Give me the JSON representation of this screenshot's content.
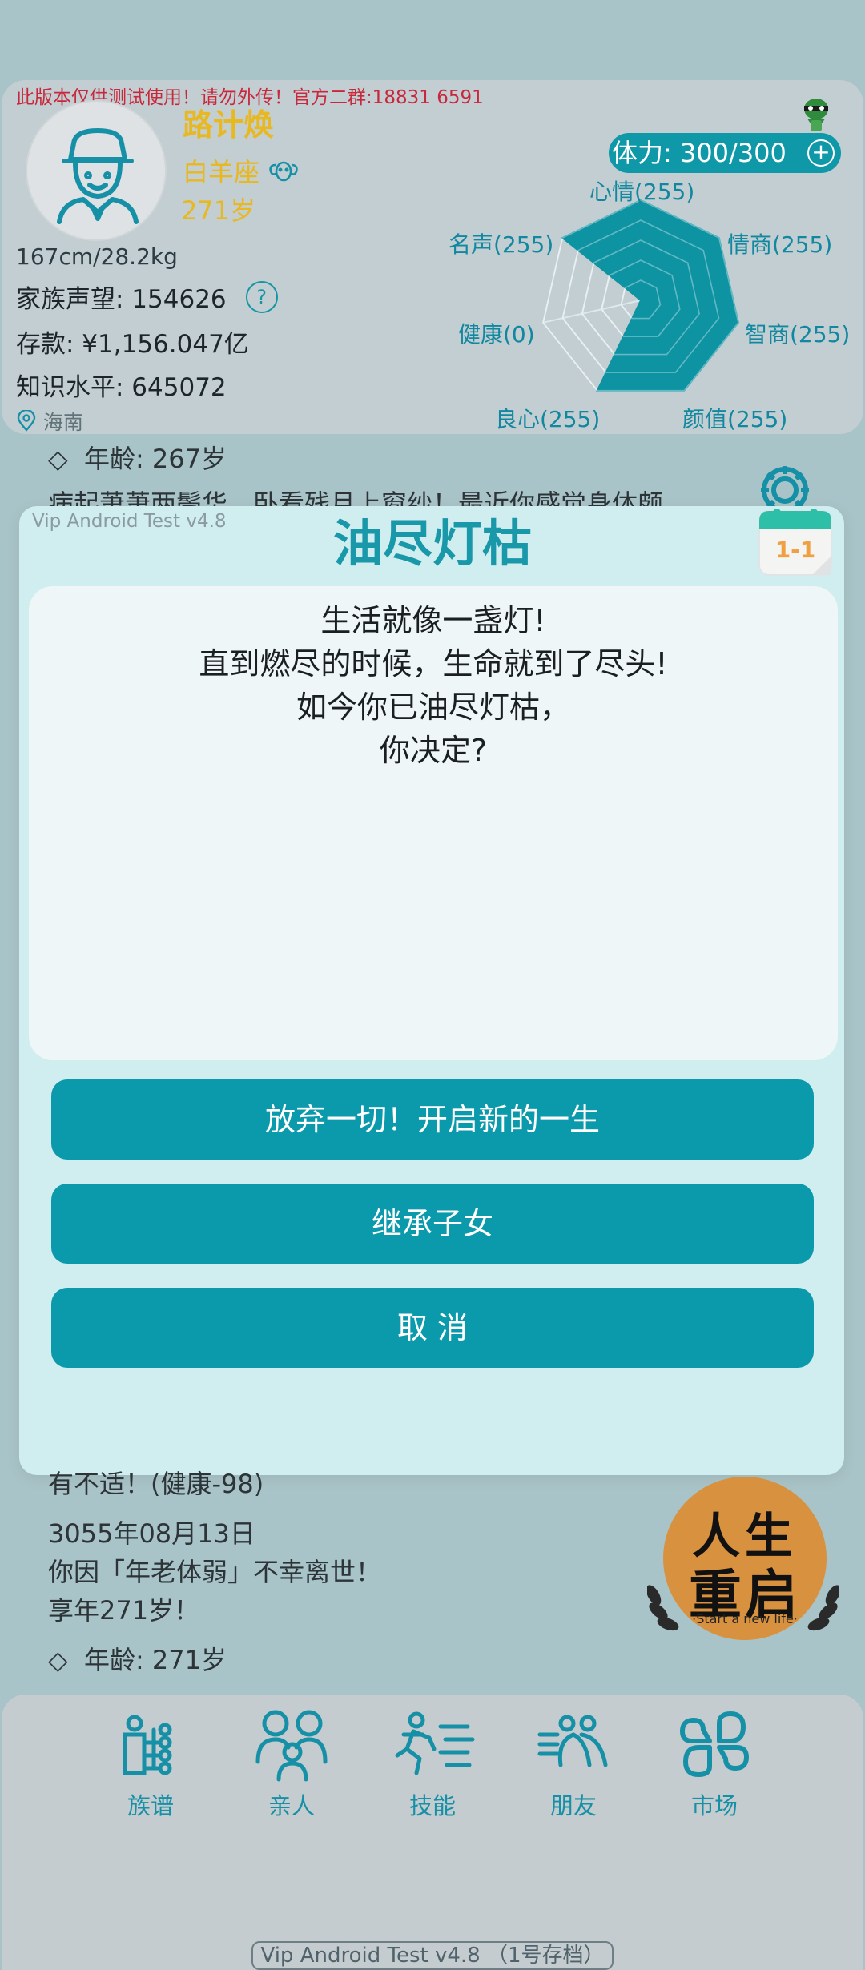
{
  "banner": {
    "warning": "此版本仅供测试使用！请勿外传！官方二群:18831 6591"
  },
  "profile": {
    "name": "路计焕",
    "zodiac": "白羊座",
    "zodiac_icon": "ram-icon",
    "age": "271岁",
    "height_weight": "167cm/28.2kg",
    "reputation": "家族声望: 154626",
    "savings": "存款: ¥1,156.047亿",
    "knowledge": "知识水平: 645072",
    "location": "海南"
  },
  "stamina": {
    "label": "体力: 300/300",
    "plus": "+"
  },
  "radar": {
    "labels": {
      "mood": "心情(255)",
      "eq": "情商(255)",
      "iq": "智商(255)",
      "looks": "颜值(255)",
      "conscience": "良心(255)",
      "health": "健康(0)",
      "fame": "名声(255)"
    },
    "values": {
      "mood": 255,
      "eq": 255,
      "iq": 255,
      "looks": 255,
      "conscience": 255,
      "health": 0,
      "fame": 255
    },
    "max": 255,
    "fill_color": "#0e93a3"
  },
  "log": {
    "age_top": "年龄: 267岁",
    "partial_top": "病起萧萧两鬓华，卧看残月上窗纱！最近你感觉身体颇",
    "partial_bottom": "有不适！(健康-98)",
    "date": "3055年08月13日",
    "death": "你因「年老体弱」不幸离世！",
    "lifespan": "享年271岁！",
    "age_bottom": "年龄: 271岁",
    "bullet": "◇"
  },
  "dialog": {
    "version": "Vip Android Test v4.8",
    "title": "油尽灯枯",
    "lines": [
      "生活就像一盏灯!",
      "直到燃尽的时候，生命就到了尽头!",
      "如今你已油尽灯枯，",
      "你决定?"
    ],
    "buttons": [
      "放弃一切！开启新的一生",
      "继承子女",
      "取  消"
    ],
    "calendar": "1-1"
  },
  "restart": {
    "line1": "人生",
    "line2": "重启",
    "subtitle": "·Start a new life·",
    "color": "#d8913e"
  },
  "nav": [
    {
      "label": "族谱",
      "icon": "family-tree-icon"
    },
    {
      "label": "亲人",
      "icon": "relatives-icon"
    },
    {
      "label": "技能",
      "icon": "skills-icon"
    },
    {
      "label": "朋友",
      "icon": "friends-icon"
    },
    {
      "label": "市场",
      "icon": "market-icon"
    }
  ],
  "footer": "Vip Android Test v4.8 （1号存档）",
  "colors": {
    "accent": "#0b9aac",
    "name": "#e8b820",
    "warning": "#c8283c"
  }
}
